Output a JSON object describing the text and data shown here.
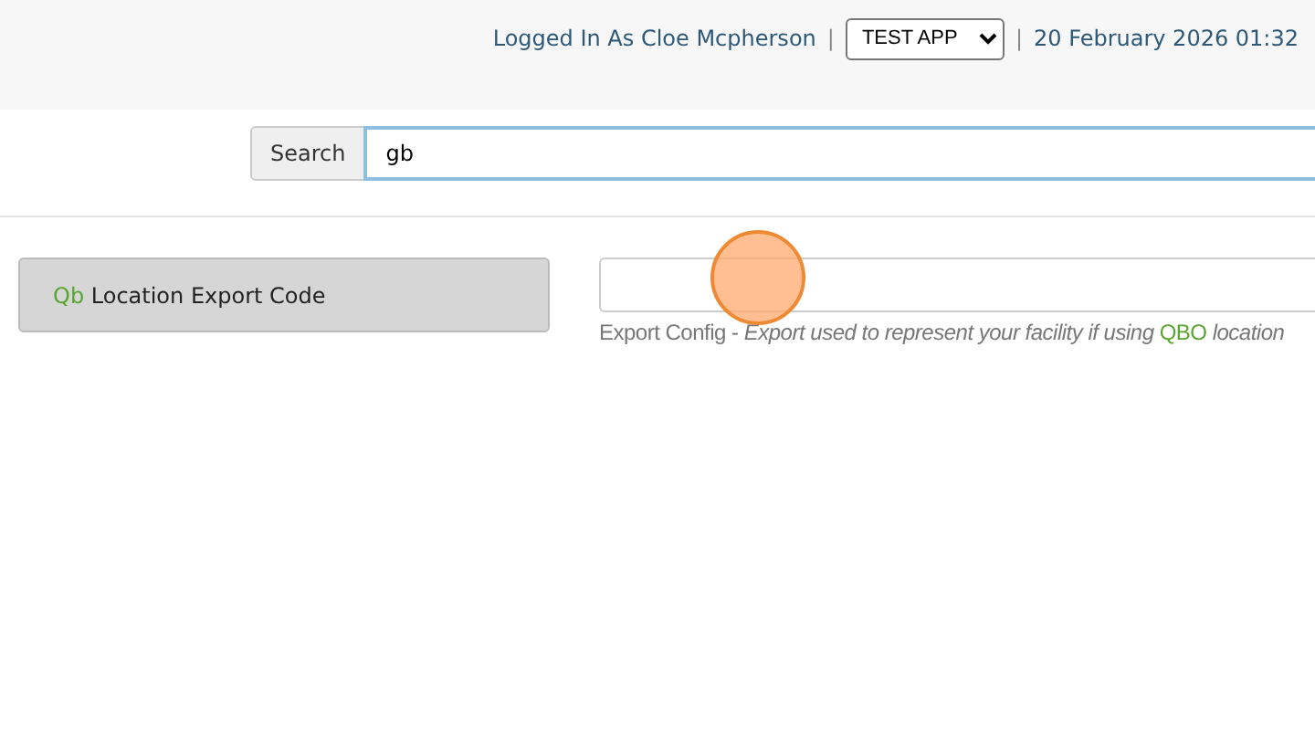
{
  "header": {
    "user_text": "Logged In As Cloe Mcpherson",
    "separator_left": "|",
    "app_select": {
      "value": "TEST APP"
    },
    "separator_right": "|",
    "datetime": "20 February 2026 01:32"
  },
  "search": {
    "button": "Search",
    "value": "gb"
  },
  "setting": {
    "label": [
      {
        "text": "Qb",
        "kind": "match"
      },
      {
        "text": " Location Export Code",
        "kind": "plain"
      }
    ],
    "hint": [
      {
        "text": "Export Config - ",
        "kind": "plain"
      },
      {
        "text": "Export used to represent your facility if using ",
        "kind": "italic"
      },
      {
        "text": "QBO",
        "kind": "match"
      },
      {
        "text": " location",
        "kind": "italic"
      }
    ]
  }
}
